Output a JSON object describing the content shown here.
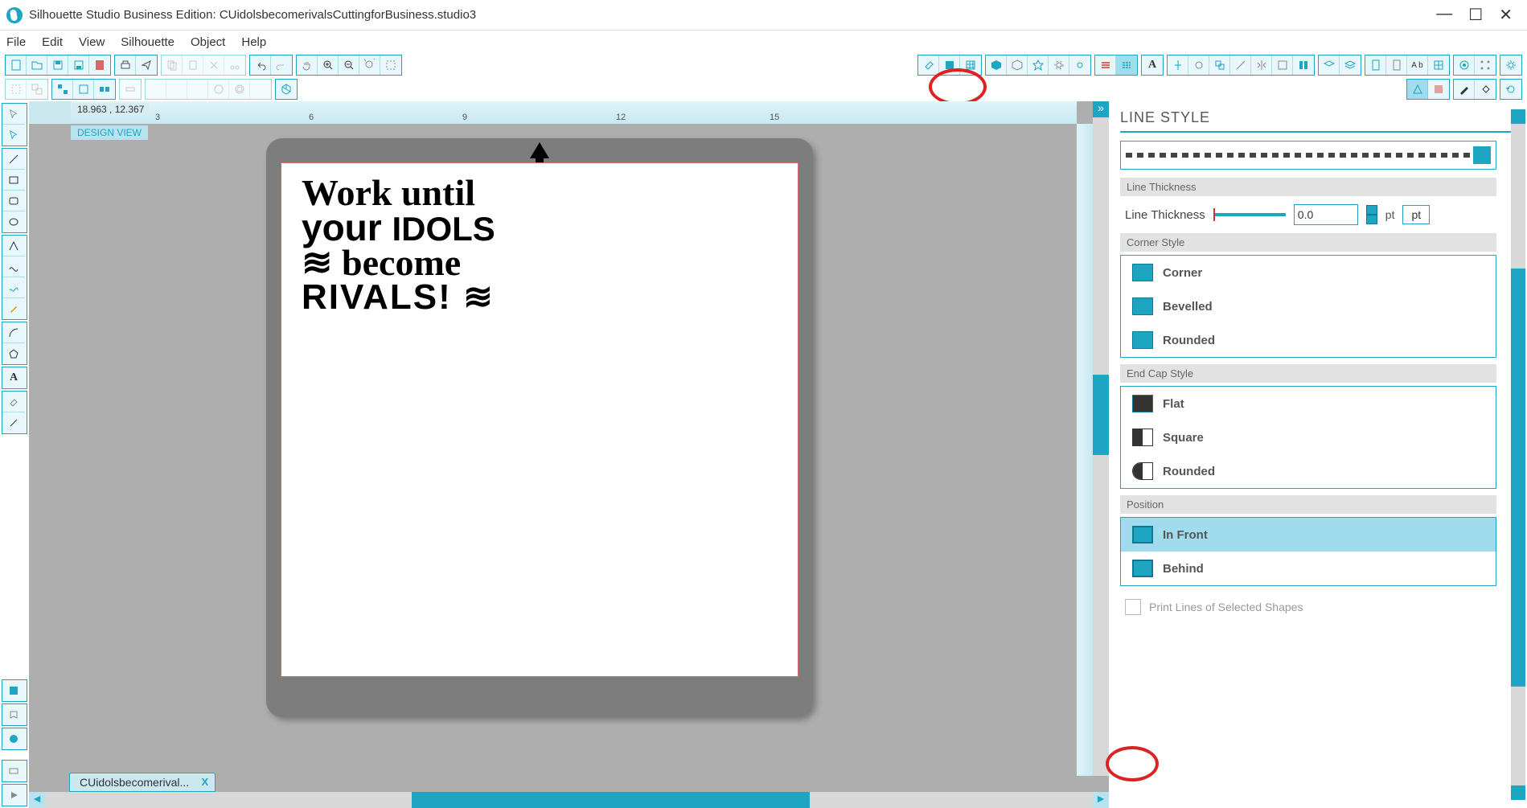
{
  "titlebar": {
    "text": "Silhouette Studio Business Edition: CUidolsbecomerivalsCuttingforBusiness.studio3"
  },
  "menubar": [
    "File",
    "Edit",
    "View",
    "Silhouette",
    "Object",
    "Help"
  ],
  "toolbar1_groups": [
    {
      "name": "file-ops",
      "items": [
        "new",
        "open",
        "save",
        "save-as",
        "print"
      ]
    },
    {
      "name": "print-ops",
      "items": [
        "printer",
        "send"
      ]
    },
    {
      "name": "clipboard",
      "items": [
        "copy",
        "paste",
        "cut",
        "scissors"
      ]
    },
    {
      "name": "undo-redo",
      "items": [
        "undo",
        "redo"
      ]
    },
    {
      "name": "pan-zoom",
      "items": [
        "hand",
        "zoom-in",
        "zoom-out",
        "zoom-fit",
        "zoom-sel"
      ]
    }
  ],
  "toolbar1_right_groups": [
    {
      "name": "erase",
      "items": [
        "eraser",
        "rect",
        "grid"
      ]
    },
    {
      "name": "shapes",
      "items": [
        "hexagon",
        "hexagon-outline",
        "star",
        "gear",
        "sun"
      ]
    },
    {
      "name": "lines",
      "items": [
        "line-color",
        "line-style"
      ]
    },
    {
      "name": "text",
      "items": [
        "A"
      ]
    },
    {
      "name": "transform",
      "items": [
        "crosshair",
        "rotate",
        "scale",
        "line",
        "mirror",
        "grid2",
        "pattern"
      ]
    },
    {
      "name": "layers",
      "items": [
        "layer1",
        "layer2"
      ]
    },
    {
      "name": "page",
      "items": [
        "page",
        "page2",
        "Ab",
        "grid3"
      ]
    },
    {
      "name": "misc",
      "items": [
        "target",
        "dots"
      ]
    },
    {
      "name": "settings",
      "items": [
        "gear"
      ]
    }
  ],
  "toolbar2_left": [
    {
      "name": "sel",
      "items": [
        "a",
        "b"
      ]
    },
    {
      "name": "group",
      "items": [
        "a",
        "b",
        "c"
      ]
    },
    {
      "name": "dist",
      "items": [
        "a"
      ]
    },
    {
      "name": "ops",
      "items": [
        "a",
        "b",
        "c",
        "d",
        "e",
        "f",
        "g"
      ]
    },
    {
      "name": "cube",
      "items": [
        "a"
      ]
    }
  ],
  "toolbar2_right": [
    {
      "name": "trace",
      "items": [
        "a",
        "b"
      ]
    },
    {
      "name": "paint",
      "items": [
        "a",
        "b"
      ]
    },
    {
      "name": "refresh",
      "items": [
        "a"
      ]
    }
  ],
  "left_tools": {
    "group1": [
      "select",
      "select2"
    ],
    "group2": [
      "line",
      "rect",
      "round-rect",
      "ellipse"
    ],
    "group3": [
      "triangle",
      "curve",
      "freehand",
      "pencil"
    ],
    "group4": [
      "arc",
      "polygon"
    ],
    "group5": [
      "text"
    ],
    "group6": [
      "eraser",
      "knife"
    ],
    "group7": [
      "rect-tool"
    ],
    "group8": [
      "book"
    ],
    "group9": [
      "logo"
    ],
    "group10": [
      "rect2"
    ],
    "group11": [
      "play"
    ]
  },
  "canvas": {
    "coords": "18.963 , 12.367",
    "badge": "DESIGN VIEW",
    "tab_label": "CUidolsbecomerival...",
    "ruler_major": [
      3,
      6,
      9,
      12,
      15
    ],
    "artwork": {
      "l1": "Work until",
      "l2a": "your ",
      "l2b": "IDOLS",
      "l3": "≋ become",
      "l4": "RIVALS! ≋"
    }
  },
  "panel": {
    "title": "LINE STYLE",
    "section_thickness": "Line Thickness",
    "label_thickness": "Line Thickness",
    "thickness_value": "0.0",
    "thickness_unit1": "pt",
    "thickness_unit2": "pt",
    "section_corner": "Corner Style",
    "corner_options": [
      "Corner",
      "Bevelled",
      "Rounded"
    ],
    "section_endcap": "End Cap Style",
    "endcap_options": [
      "Flat",
      "Square",
      "Rounded"
    ],
    "section_position": "Position",
    "position_options": [
      "In Front",
      "Behind"
    ],
    "position_selected": 0,
    "print_lines_label": "Print Lines of Selected Shapes"
  }
}
